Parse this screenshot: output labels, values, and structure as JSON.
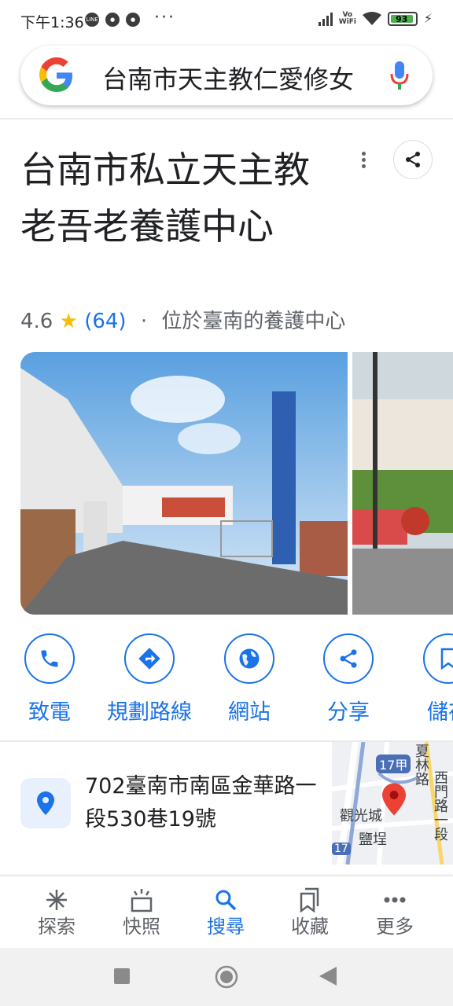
{
  "status_bar": {
    "time": "下午1:36",
    "left_icons": [
      "line-icon",
      "chrome-icon",
      "chrome-icon"
    ],
    "more": "···",
    "vowifi": "Vo WiFi",
    "battery": "93"
  },
  "search": {
    "query": "台南市天主教仁愛修女"
  },
  "place": {
    "title": "台南市私立天主教老吾老養護中心",
    "rating": "4.6",
    "review_count": "(64)",
    "separator": "·",
    "category": "位於臺南的養護中心"
  },
  "actions": [
    {
      "label": "致電",
      "icon": "phone-icon"
    },
    {
      "label": "規劃路線",
      "icon": "directions-icon"
    },
    {
      "label": "網站",
      "icon": "globe-icon"
    },
    {
      "label": "分享",
      "icon": "share-icon"
    },
    {
      "label": "儲存",
      "icon": "bookmark-icon"
    }
  ],
  "address": {
    "line": "702臺南市南區金華路一段530巷19號"
  },
  "map": {
    "labels": [
      "17甲",
      "夏林路",
      "西門路一段",
      "觀光城",
      "鹽埕",
      "17"
    ]
  },
  "bottom_nav": [
    {
      "label": "探索",
      "icon": "explore-icon"
    },
    {
      "label": "快照",
      "icon": "snapshot-icon"
    },
    {
      "label": "搜尋",
      "icon": "search-icon"
    },
    {
      "label": "收藏",
      "icon": "collections-icon"
    },
    {
      "label": "更多",
      "icon": "more-icon"
    }
  ],
  "colors": {
    "accent": "#1a73e8",
    "star": "#fbbc04",
    "text": "#202124",
    "secondary": "#5f6368"
  }
}
